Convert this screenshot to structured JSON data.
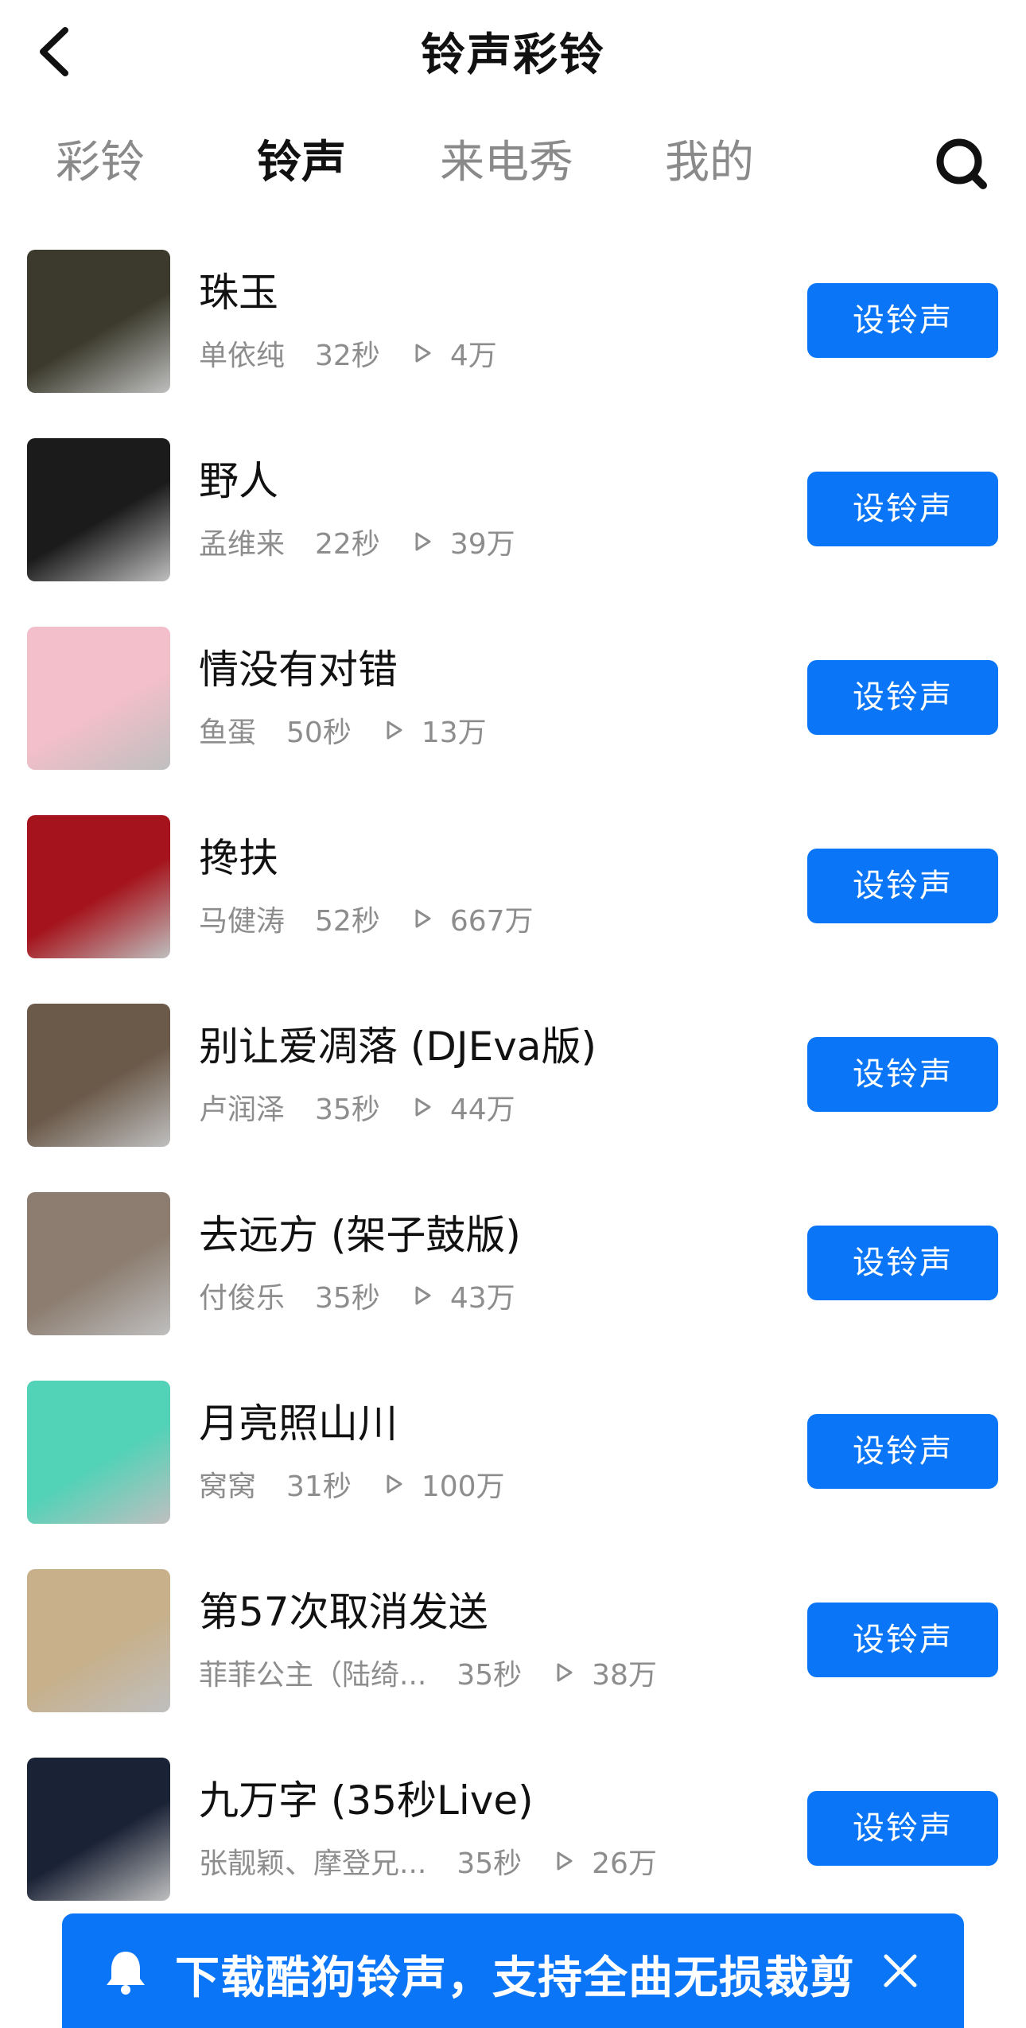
{
  "header": {
    "title": "铃声彩铃"
  },
  "tabs": [
    {
      "label": "彩铃",
      "active": false
    },
    {
      "label": "铃声",
      "active": true
    },
    {
      "label": "来电秀",
      "active": false
    },
    {
      "label": "我的",
      "active": false
    }
  ],
  "set_button_label": "设铃声",
  "items": [
    {
      "title": "珠玉",
      "artist": "单依纯",
      "duration": "32秒",
      "plays": "4万",
      "cover_color": "#3b3a2c"
    },
    {
      "title": "野人",
      "artist": "孟维来",
      "duration": "22秒",
      "plays": "39万",
      "cover_color": "#1b1b1b"
    },
    {
      "title": "情没有对错",
      "artist": "鱼蛋",
      "duration": "50秒",
      "plays": "13万",
      "cover_color": "#f3bfca"
    },
    {
      "title": "搀扶",
      "artist": "马健涛",
      "duration": "52秒",
      "plays": "667万",
      "cover_color": "#a5141c"
    },
    {
      "title": "别让爱凋落 (DJEva版)",
      "artist": "卢润泽",
      "duration": "35秒",
      "plays": "44万",
      "cover_color": "#6b5a4a"
    },
    {
      "title": "去远方 (架子鼓版)",
      "artist": "付俊乐",
      "duration": "35秒",
      "plays": "43万",
      "cover_color": "#8c7d70"
    },
    {
      "title": "月亮照山川",
      "artist": "窝窝",
      "duration": "31秒",
      "plays": "100万",
      "cover_color": "#52d2b7"
    },
    {
      "title": "第57次取消发送",
      "artist": "菲菲公主（陆绮...",
      "duration": "35秒",
      "plays": "38万",
      "cover_color": "#c7b08a"
    },
    {
      "title": "九万字 (35秒Live)",
      "artist": "张靓颖、摩登兄...",
      "duration": "35秒",
      "plays": "26万",
      "cover_color": "#1a2235"
    }
  ],
  "banner": {
    "text": "下载酷狗铃声，支持全曲无损裁剪"
  },
  "icons": {
    "back": "chevron-left-icon",
    "search": "search-icon",
    "play": "play-icon",
    "bell": "bell-icon",
    "close": "close-icon"
  },
  "colors": {
    "accent": "#0a76f7",
    "muted": "#8d8d8d"
  }
}
